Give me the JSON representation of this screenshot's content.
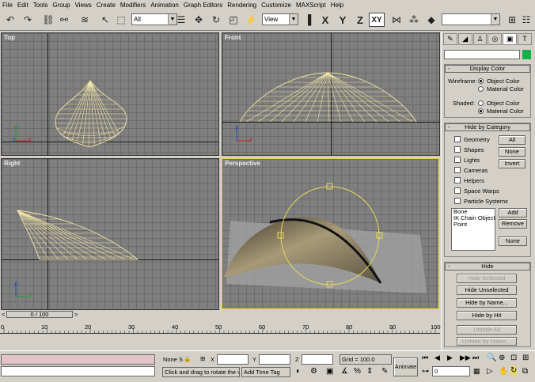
{
  "menu": [
    "File",
    "Edit",
    "Tools",
    "Group",
    "Views",
    "Create",
    "Modifiers",
    "Animation",
    "Graph Editors",
    "Rendering",
    "Customize",
    "MAXScript",
    "Help"
  ],
  "toolbar": {
    "filter_value": "All",
    "refcoord_value": "View",
    "axis_x": "X",
    "axis_y": "Y",
    "axis_z": "Z",
    "axis_xy": "XY"
  },
  "viewports": {
    "top": "Top",
    "front": "Front",
    "right": "Right",
    "perspective": "Perspective"
  },
  "axis_labels": {
    "x": "x",
    "y": "y",
    "z": "z"
  },
  "colors": {
    "active_viewport": "#e8d85a",
    "wireframe": "#f2e3a6",
    "object_color_swatch": "#14b04a"
  },
  "command_panel": {
    "display_color": {
      "title": "Display Color",
      "wireframe_label": "Wireframe:",
      "shaded_label": "Shaded:",
      "object_color": "Object Color",
      "material_color": "Material Color",
      "wireframe_selected": "Object Color",
      "shaded_selected": "Material Color"
    },
    "hide_by_category": {
      "title": "Hide by Category",
      "categories": [
        "Geometry",
        "Shapes",
        "Lights",
        "Cameras",
        "Helpers",
        "Space Warps",
        "Particle Systems"
      ],
      "all": "All",
      "none": "None",
      "invert": "Invert",
      "list_items": [
        "Bone",
        "IK Chain Object",
        "Point"
      ],
      "add": "Add",
      "remove": "Remove",
      "none2": "None"
    },
    "hide": {
      "title": "Hide",
      "hide_selected": "Hide Selected",
      "hide_unselected": "Hide Unselected",
      "hide_by_name": "Hide by Name...",
      "hide_by_hit": "Hide by Hit",
      "unhide_all": "Unhide All",
      "unhide_by_name": "Unhide by Name..."
    }
  },
  "timeline": {
    "slider": "0 / 100",
    "ticks": [
      "0",
      "10",
      "20",
      "30",
      "40",
      "50",
      "60",
      "70",
      "80",
      "90",
      "100"
    ]
  },
  "status": {
    "selection": "None S",
    "x_label": "X",
    "y_label": "Y",
    "z_label": "Z",
    "grid": "Grid = 100.0",
    "prompt": "Click and drag to rotate the vie",
    "add_time_tag": "Add Time Tag",
    "animate": "Animate",
    "frame": "0"
  }
}
